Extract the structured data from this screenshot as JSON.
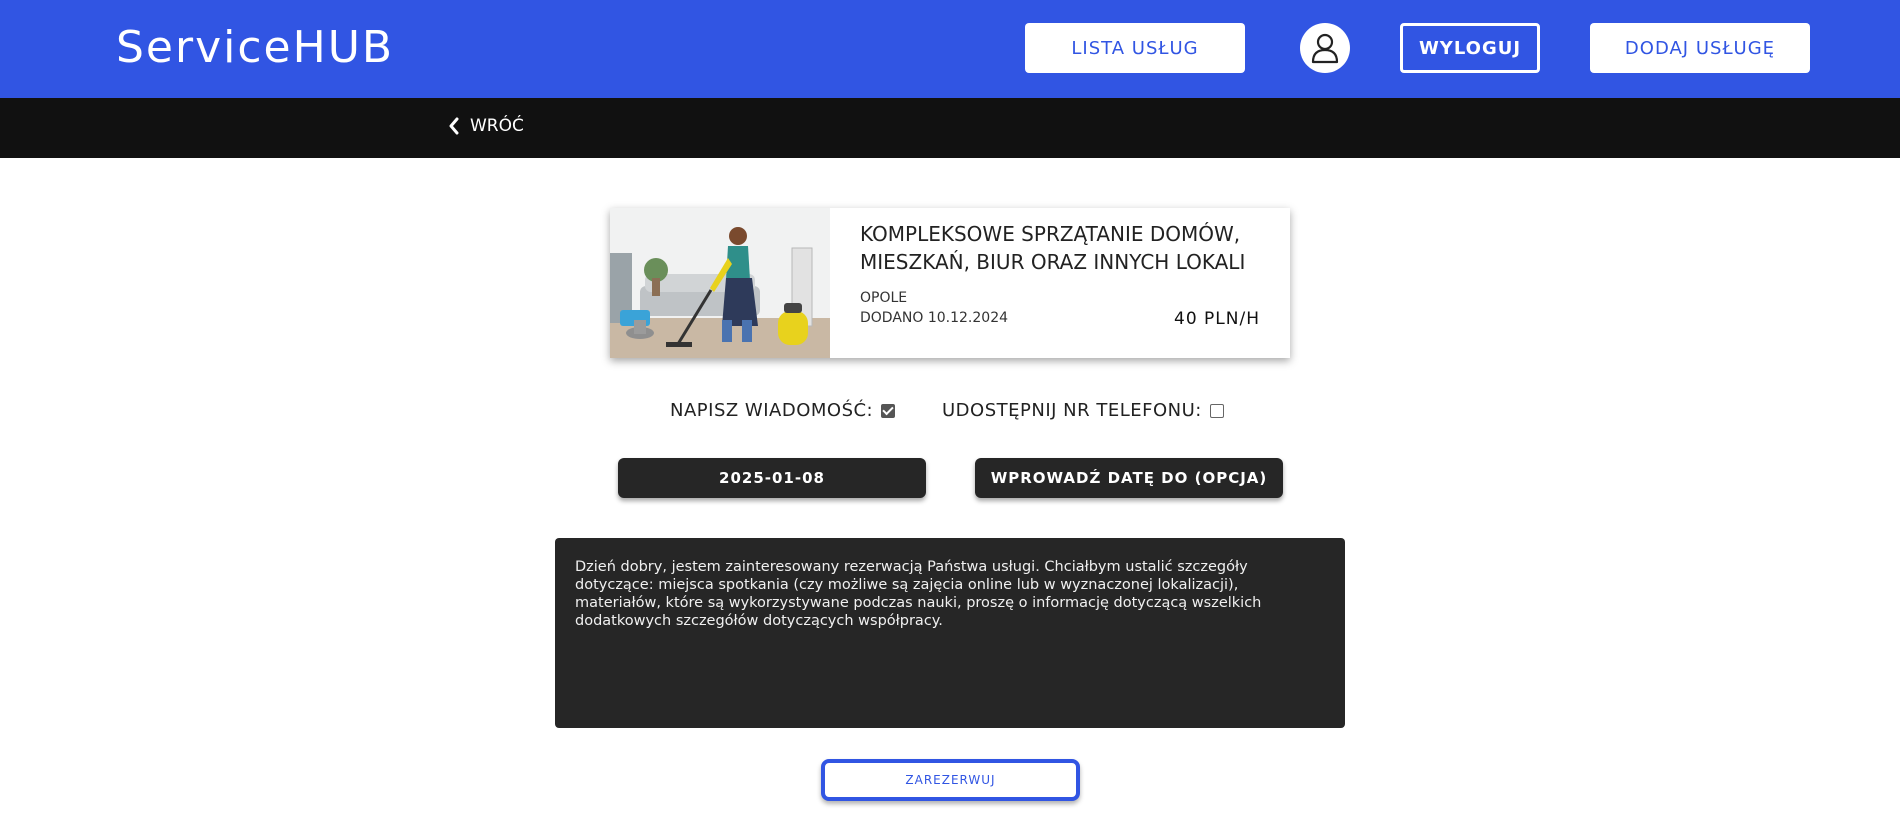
{
  "header": {
    "logo": "ServiceHUB",
    "list_label": "LISTA USŁUG",
    "logout_label": "WYLOGUJ",
    "add_label": "DODAJ USŁUGĘ",
    "avatar_icon": "user-icon"
  },
  "subbar": {
    "back_label": "WRÓĆ",
    "back_icon": "chevron-left-icon"
  },
  "card": {
    "title": "KOMPLEKSOWE SPRZĄTANIE DOMÓW, MIESZKAŃ, BIUR ORAZ INNYCH LOKALI",
    "city": "OPOLE",
    "date": "DODANO 10.12.2024",
    "price": "40 PLN/H"
  },
  "options": {
    "message_label": "NAPISZ WIADOMOŚĆ:",
    "message_checked": true,
    "phone_label": "UDOSTĘPNIJ NR TELEFONU:",
    "phone_checked": false
  },
  "dates": {
    "from": "2025-01-08",
    "to": "WPROWADŹ DATĘ DO (OPCJA)"
  },
  "message": {
    "text": "Dzień dobry, jestem zainteresowany rezerwacją Państwa usługi. Chciałbym ustalić szczegóły dotyczące: miejsca spotkania (czy możliwe są zajęcia online lub w wyznaczonej lokalizacji), materiałów, które są wykorzystywane podczas nauki, proszę o informację dotyczącą wszelkich dodatkowych szczegółów dotyczących współpracy."
  },
  "submit_label": "ZAREZERWUJ",
  "colors": {
    "primary": "#3155e3",
    "dark": "#262626",
    "subbar": "#111111"
  }
}
